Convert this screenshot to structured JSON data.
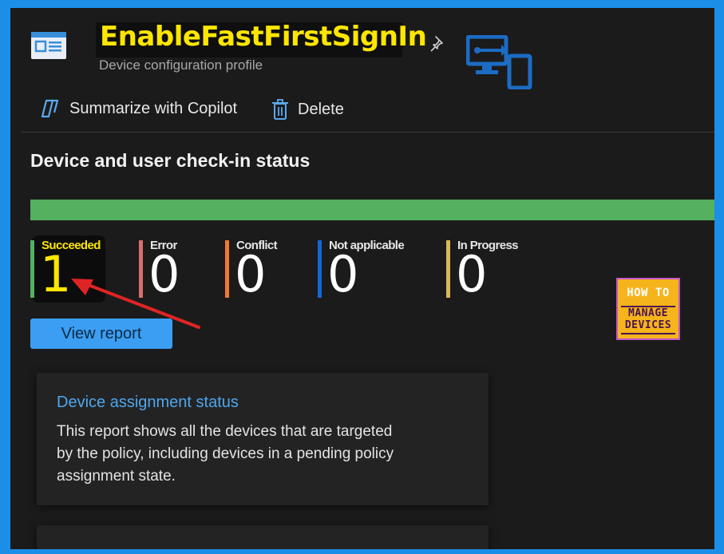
{
  "header": {
    "title": "EnableFastFirstSignIn",
    "subtitle": "Device configuration profile",
    "more_label": "···"
  },
  "toolbar": {
    "copilot_label": "Summarize with Copilot",
    "delete_label": "Delete"
  },
  "section": {
    "title": "Device and user check-in status"
  },
  "status_bar_color": "#55b060",
  "metrics": [
    {
      "label": "Succeeded",
      "value": "1",
      "color": "#55b060"
    },
    {
      "label": "Error",
      "value": "0",
      "color": "#e06c6c"
    },
    {
      "label": "Conflict",
      "value": "0",
      "color": "#f07a2e"
    },
    {
      "label": "Not applicable",
      "value": "0",
      "color": "#1665d8"
    },
    {
      "label": "In Progress",
      "value": "0",
      "color": "#d8b85a"
    }
  ],
  "view_report_label": "View report",
  "watermark": {
    "line1": "HOW TO",
    "line2": "MANAGE",
    "line3": "DEVICES"
  },
  "card": {
    "title": "Device assignment status",
    "description": "This report shows all the devices that are targeted by the policy, including devices in a pending policy assignment state."
  }
}
